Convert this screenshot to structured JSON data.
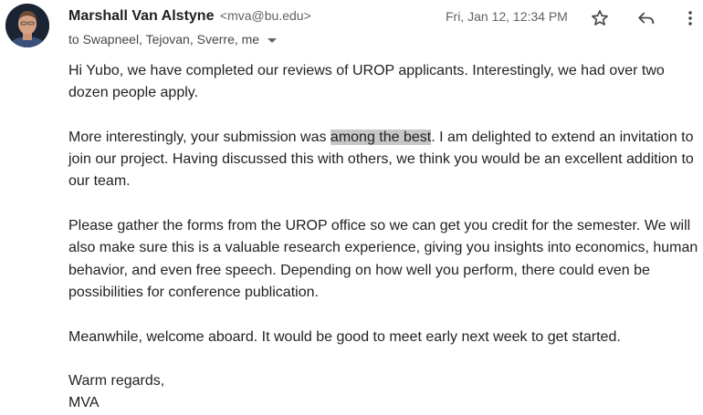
{
  "sender": {
    "name": "Marshall Van Alstyne",
    "email": "<mva@bu.edu>"
  },
  "recipients": "to Swapneel, Tejovan, Sverre, me",
  "date": "Fri, Jan 12, 12:34 PM",
  "icons": {
    "avatar": "sender-avatar",
    "star": "star-outline-icon",
    "reply": "reply-icon",
    "more": "more-vert-icon",
    "expand": "chevron-down-icon"
  },
  "colors": {
    "highlight": "#c7c7c7",
    "secondary_text": "#5f6368"
  },
  "body": {
    "p1": "Hi Yubo, we have completed our reviews of UROP applicants.  Interestingly, we had over two dozen people apply.",
    "p2_before": "More interestingly, your submission was ",
    "p2_highlight": "among the best",
    "p2_after": ".  I am delighted to extend an invitation to join our project.  Having discussed this with others, we think you would be an excellent addition to our team.",
    "p3": "Please gather the forms from the UROP office so we can get you credit for the semester.  We will also make sure this is a valuable research experience, giving you insights into economics, human behavior, and even free speech.  Depending on how well you perform, there could even be possibilities for conference publication.",
    "p4": "Meanwhile, welcome aboard.  It would be good to meet early next week to get started.",
    "closing": "Warm regards,",
    "signature": "MVA"
  }
}
